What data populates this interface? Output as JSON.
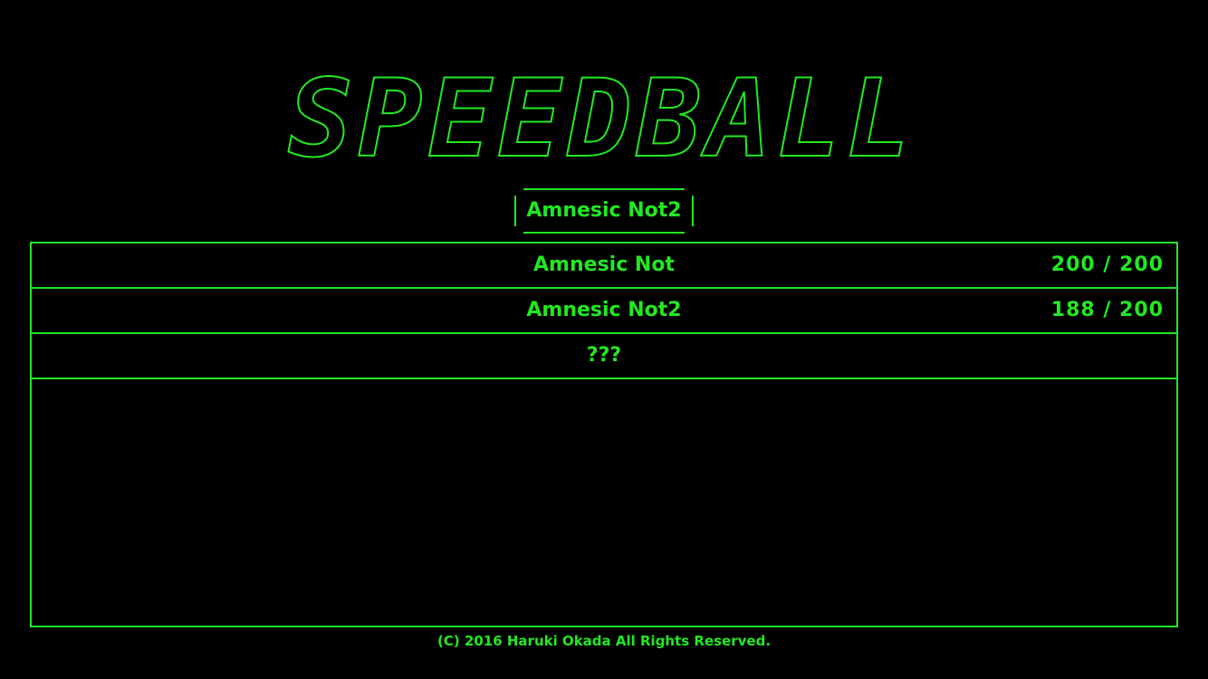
{
  "logo": {
    "text": "SPEEDBALL"
  },
  "selected": {
    "label": "Amnesic Not2"
  },
  "stages": [
    {
      "name": "Amnesic Not",
      "score": "200 / 200"
    },
    {
      "name": "Amnesic Not2",
      "score": "188 / 200"
    },
    {
      "name": "???",
      "score": ""
    }
  ],
  "footer": {
    "copyright": "(C) 2016 Haruki Okada All Rights Reserved."
  },
  "colors": {
    "background": "#000000",
    "accent": "#22e822"
  }
}
